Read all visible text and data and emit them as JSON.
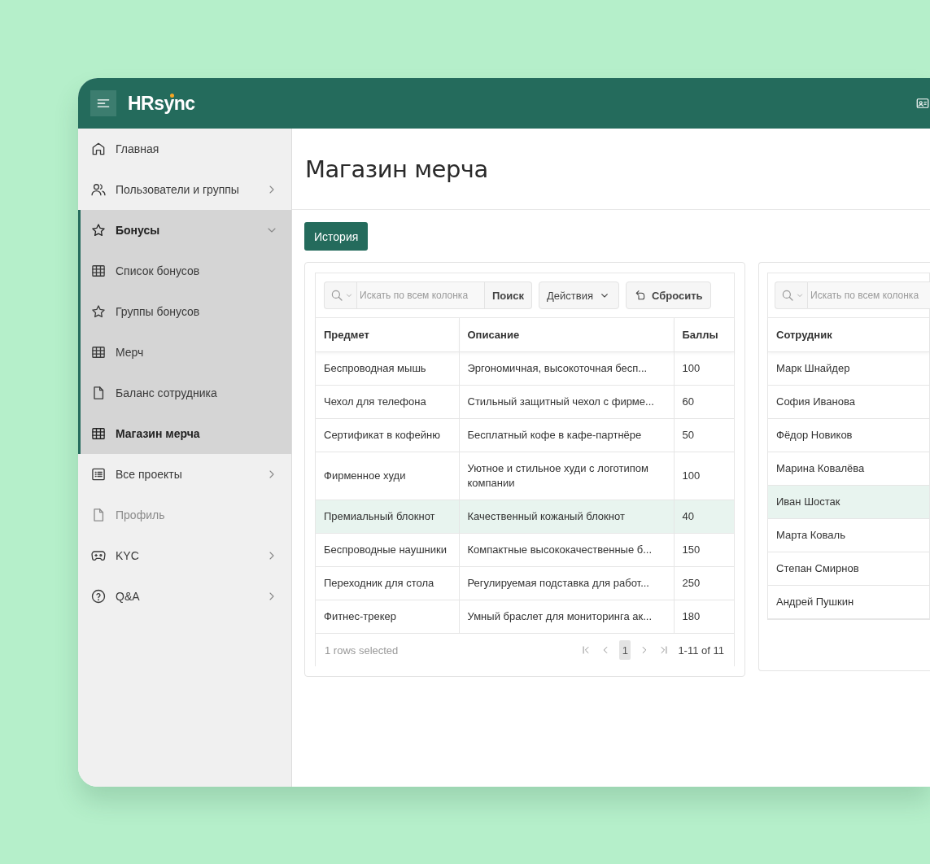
{
  "header": {
    "logo": "HRsync"
  },
  "sidebar": {
    "items": [
      {
        "label": "Главная",
        "disabled": false
      },
      {
        "label": "Пользователи и группы",
        "disabled": false,
        "expanded": false
      },
      {
        "label": "Бонусы",
        "disabled": false,
        "expanded": true,
        "children": [
          {
            "label": "Список бонусов",
            "selected": false
          },
          {
            "label": "Группы бонусов",
            "selected": false
          },
          {
            "label": "Мерч",
            "selected": false
          },
          {
            "label": "Баланс сотрудника",
            "selected": false
          },
          {
            "label": "Магазин мерча",
            "selected": true
          }
        ]
      },
      {
        "label": "Все проекты",
        "disabled": false,
        "expanded": false
      },
      {
        "label": "Профиль",
        "disabled": true
      },
      {
        "label": "KYC",
        "disabled": false,
        "expanded": false
      },
      {
        "label": "Q&A",
        "disabled": false,
        "expanded": false
      }
    ]
  },
  "main": {
    "title": "Магазин мерча",
    "history_button": "История"
  },
  "panels": [
    {
      "search": {
        "placeholder": "Искать по всем колонка",
        "button": "Поиск"
      },
      "actions_button": "Действия",
      "reset_button": "Сбросить",
      "columns": [
        "Предмет",
        "Описание",
        "Баллы"
      ],
      "rows": [
        {
          "cells": [
            "Беспроводная мышь",
            "Эргономичная, высокоточная бесп...",
            "100"
          ],
          "selected": false
        },
        {
          "cells": [
            "Чехол для телефона",
            "Стильный защитный чехол с фирме...",
            "60"
          ],
          "selected": false
        },
        {
          "cells": [
            "Сертификат в кофейню",
            "Бесплатный кофе в кафе-партнёре",
            "50"
          ],
          "selected": false
        },
        {
          "cells": [
            "Фирменное худи",
            "Уютное и стильное худи с логотипом компании",
            "100"
          ],
          "selected": false
        },
        {
          "cells": [
            "Премиальный блокнот",
            "Качественный кожаный блокнот",
            "40"
          ],
          "selected": true
        },
        {
          "cells": [
            "Беспроводные наушники",
            "Компактные высококачественные б...",
            "150"
          ],
          "selected": false
        },
        {
          "cells": [
            "Переходник для стола",
            "Регулируемая подставка для работ...",
            "250"
          ],
          "selected": false
        },
        {
          "cells": [
            "Фитнес-трекер",
            "Умный браслет для мониторинга ак...",
            "180"
          ],
          "selected": false
        }
      ],
      "footer": {
        "selection": "1 rows selected",
        "pages": [
          {
            "label": "1",
            "selected": true
          }
        ],
        "range": "1-11 of 11"
      }
    },
    {
      "search": {
        "placeholder": "Искать по всем колонка"
      },
      "columns": [
        "Сотрудник"
      ],
      "rows": [
        {
          "cells": [
            "Марк Шнайдер"
          ],
          "selected": false
        },
        {
          "cells": [
            "София Иванова"
          ],
          "selected": false
        },
        {
          "cells": [
            "Фёдор Новиков"
          ],
          "selected": false
        },
        {
          "cells": [
            "Марина Ковалёва"
          ],
          "selected": false
        },
        {
          "cells": [
            "Иван Шостак"
          ],
          "selected": true
        },
        {
          "cells": [
            "Марта Коваль"
          ],
          "selected": false
        },
        {
          "cells": [
            "Степан  Смирнов"
          ],
          "selected": false
        },
        {
          "cells": [
            "Андрей Пушкин"
          ],
          "selected": false
        }
      ]
    }
  ]
}
